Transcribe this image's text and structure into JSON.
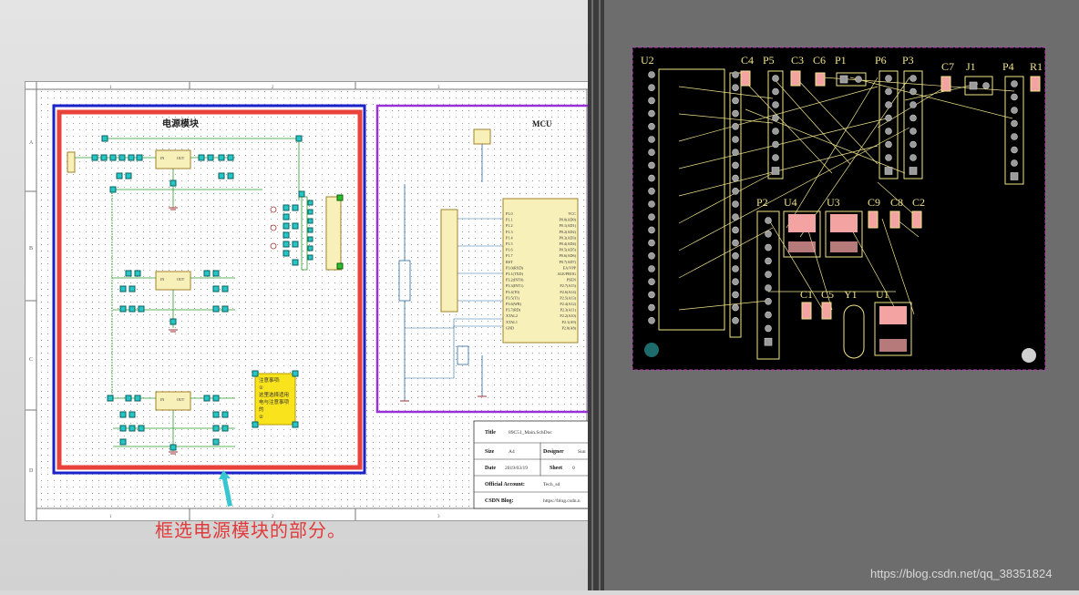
{
  "schematic": {
    "power_block_title": "电源模块",
    "mcu_block_title": "MCU",
    "col_labels": [
      "1",
      "2",
      "3"
    ],
    "row_labels": [
      "A",
      "B",
      "C",
      "D"
    ],
    "regulator_pin_in": "IN",
    "regulator_pin_out": "OUT",
    "regulator_pin_gnd": "GND",
    "note_label": "注意事项:",
    "note_lines": [
      "①",
      "这里选择适用",
      "电与注意事项",
      "的",
      "②"
    ],
    "mcu_pins_left": [
      "P1.0",
      "P1.1",
      "P1.2",
      "P1.3",
      "P1.4",
      "P1.5",
      "P1.6",
      "P1.7",
      "RST",
      "P3.0(RXD)",
      "P3.1(TXD)",
      "P3.2(INT0)",
      "P3.3(INT1)",
      "P3.4(T0)",
      "P3.5(T1)",
      "P3.6(WR)",
      "P3.7(RD)",
      "XTAL2",
      "XTAL1",
      "GND"
    ],
    "mcu_pins_right": [
      "VCC",
      "P0.0(AD0)",
      "P0.1(AD1)",
      "P0.2(AD2)",
      "P0.3(AD3)",
      "P0.4(AD4)",
      "P0.5(AD5)",
      "P0.6(AD6)",
      "P0.7(AD7)",
      "EA/VPP",
      "ALE/PROG",
      "PSEN",
      "P2.7(A15)",
      "P2.6(A14)",
      "P2.5(A13)",
      "P2.4(A12)",
      "P2.3(A11)",
      "P2.2(A10)",
      "P2.1(A9)",
      "P2.0(A8)"
    ],
    "title_block": {
      "title_label": "Title",
      "title_value": "89C51_Main.SchDoc",
      "size_label": "Size",
      "size_value": "A4",
      "designer_label": "Designer",
      "designer_value": "Sun",
      "date_label": "Date",
      "date_value": "2019/03/19",
      "sheet_label": "Sheet",
      "sheet_value": "0",
      "account_label": "Official Account:",
      "account_value": "Tech_sd",
      "blog_label": "CSDN Blog:",
      "blog_value": "https://blog.csdn.n"
    }
  },
  "caption": "框选电源模块的部分。",
  "pcb": {
    "labels_top": [
      "U2",
      "C4",
      "P5",
      "C3",
      "C6",
      "P1",
      "P6",
      "P3",
      "C7",
      "J1",
      "P4",
      "R1"
    ],
    "labels_mid": [
      "P2",
      "U4",
      "U3",
      "C9",
      "C8",
      "C2"
    ],
    "labels_low": [
      "C1",
      "C5",
      "Y1",
      "U1"
    ]
  },
  "watermark": "https://blog.csdn.net/qq_38351824",
  "colors": {
    "power_box_red": "#e8423a",
    "power_box_blue": "#1a22c8",
    "mcu_box_purple": "#9b30d9",
    "pcb_silk": "#f0e38a",
    "pcb_pad": "#f4a3a3"
  }
}
